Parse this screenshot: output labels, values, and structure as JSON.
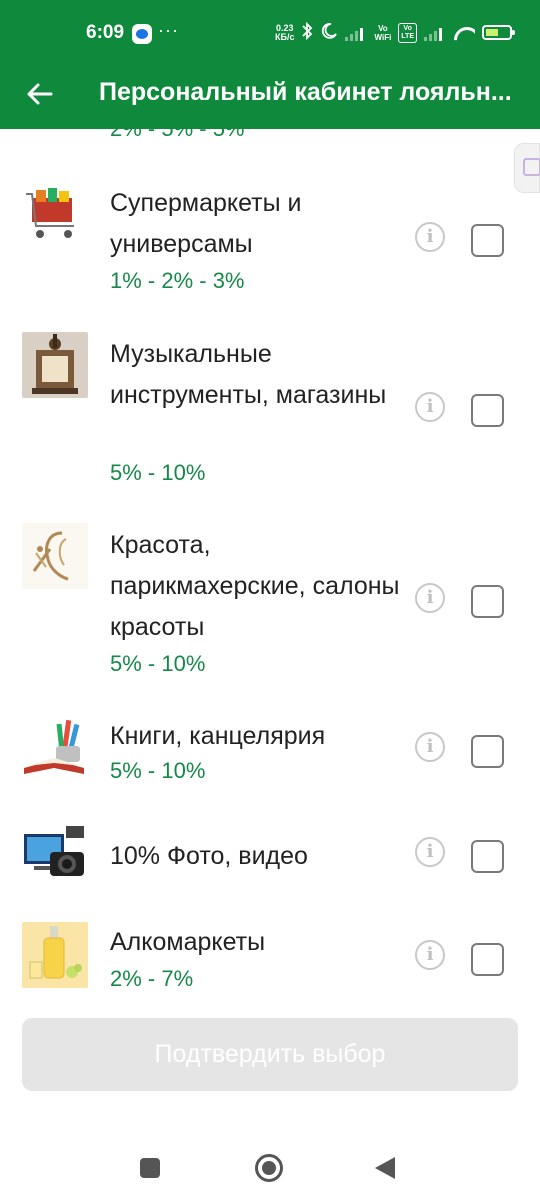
{
  "status": {
    "time": "6:09",
    "dots": "···",
    "speed_value": "0.23",
    "speed_unit": "КБ/с",
    "vo_wifi_1": "Vo",
    "vo_wifi_2": "WiFi",
    "vo_lte_1": "Vo",
    "vo_lte_2": "LTE"
  },
  "appbar": {
    "title": "Персональный кабинет лояльн..."
  },
  "partial_row": {
    "percent": "2% - 5% - 5%"
  },
  "rows": [
    {
      "name": "Супермаркеты и универсамы",
      "percent": "1% - 2% - 3%",
      "icon": "shopping-cart-image"
    },
    {
      "name": "Музыкальные инструменты, магазины",
      "percent": "5% - 10%",
      "icon": "musical-instruments-image"
    },
    {
      "name": "Красота, парикмахерские, салоны красоты",
      "percent": "5% - 10%",
      "icon": "beauty-salon-image"
    },
    {
      "name": "Книги, канцелярия",
      "percent": "5% - 10%",
      "icon": "book-stationery-image"
    },
    {
      "name": "10% Фото, видео",
      "percent": "",
      "icon": "photo-video-image"
    },
    {
      "name": "Алкомаркеты",
      "percent": "2% - 7%",
      "icon": "liquor-image"
    }
  ],
  "info_glyph": "i",
  "confirm_button": "Подтвердить выбор",
  "colors": {
    "primary": "#0f8a3c",
    "percent_text": "#16884a",
    "disabled_button": "#e5e5e5"
  }
}
